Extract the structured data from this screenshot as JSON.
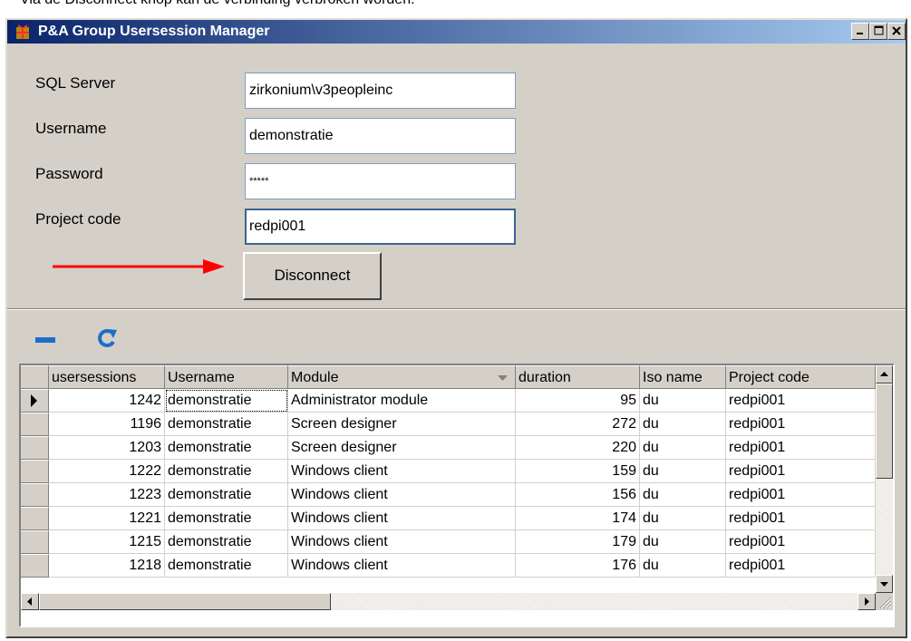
{
  "caption": "Via de Disconnect knop kan de verbinding verbroken worden.",
  "window": {
    "title": "P&A Group Usersession Manager",
    "buttons": [
      "minimize",
      "maximize",
      "close"
    ]
  },
  "form": {
    "sql_server": {
      "label": "SQL Server",
      "value": "zirkonium\\v3peopleinc"
    },
    "username": {
      "label": "Username",
      "value": "demonstratie"
    },
    "password": {
      "label": "Password",
      "value": "*****"
    },
    "project_code": {
      "label": "Project code",
      "value": "redpi001"
    },
    "disconnect_label": "Disconnect"
  },
  "toolbar": {
    "icons": [
      "remove-icon",
      "refresh-icon"
    ]
  },
  "grid": {
    "columns": [
      "usersessions",
      "Username",
      "Module",
      "duration",
      "Iso name",
      "Project code"
    ],
    "rows": [
      {
        "id": "1242",
        "user": "demonstratie",
        "module": "Administrator module",
        "duration": "95",
        "iso": "du",
        "project": "redpi001"
      },
      {
        "id": "1196",
        "user": "demonstratie",
        "module": "Screen designer",
        "duration": "272",
        "iso": "du",
        "project": "redpi001"
      },
      {
        "id": "1203",
        "user": "demonstratie",
        "module": "Screen designer",
        "duration": "220",
        "iso": "du",
        "project": "redpi001"
      },
      {
        "id": "1222",
        "user": "demonstratie",
        "module": "Windows client",
        "duration": "159",
        "iso": "du",
        "project": "redpi001"
      },
      {
        "id": "1223",
        "user": "demonstratie",
        "module": "Windows client",
        "duration": "156",
        "iso": "du",
        "project": "redpi001"
      },
      {
        "id": "1221",
        "user": "demonstratie",
        "module": "Windows client",
        "duration": "174",
        "iso": "du",
        "project": "redpi001"
      },
      {
        "id": "1215",
        "user": "demonstratie",
        "module": "Windows client",
        "duration": "179",
        "iso": "du",
        "project": "redpi001"
      },
      {
        "id": "1218",
        "user": "demonstratie",
        "module": "Windows client",
        "duration": "176",
        "iso": "du",
        "project": "redpi001"
      }
    ],
    "current_row": 0
  },
  "colors": {
    "title_start": "#0a246a",
    "title_end": "#a6caf0",
    "arrow": "#ff0000",
    "toolbar_icon": "#1e6ec8"
  }
}
